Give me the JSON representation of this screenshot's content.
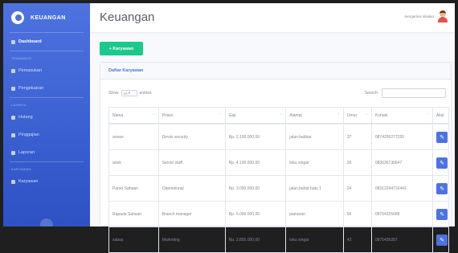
{
  "sidebar": {
    "brand": "KEUANGAN",
    "dashboard": "Dashboard",
    "heading_1": "TRANSAKSI",
    "items_1": [
      "Pemasukan",
      "Pengeluaran"
    ],
    "heading_2": "LAINNYA",
    "items_2": [
      "Hutang",
      "Pinggajian",
      "Laporan"
    ],
    "heading_3": "KARYAWAN",
    "items_3": [
      "Karyawan"
    ]
  },
  "topbar": {
    "title": "Keuangan",
    "user": "mergarinsi nikalan"
  },
  "main": {
    "add_button": "+ Karyawan",
    "card_title": "Daftar Karyawan",
    "show_label": "Show",
    "show_value": "10",
    "entries_label": "entries",
    "search_label": "Search:",
    "columns": [
      "Nama",
      "Posisi",
      "Gaji",
      "Alamat",
      "Umur",
      "Kontak",
      "Aksi"
    ],
    "rows": [
      [
        "arwan",
        "Devisi security",
        "Rp. 2.100.000,00",
        "jalan.babbar",
        "37",
        "0874256277255"
      ],
      [
        "anok",
        "Senior staff",
        "Rp. 4.100.000,00",
        "toku singar",
        "26",
        "083636736647"
      ],
      [
        "Paran Sahaan",
        "Operasional",
        "Rp. 3.000.000,00",
        "jalan.bahat batu 1",
        "24",
        "08312244716441"
      ],
      [
        "Rapada Sahaan",
        "Branch manager",
        "Rp. 6.000.000,00",
        "pamaran",
        "56",
        "08764325688"
      ],
      [
        "sabas",
        "Marketing",
        "Rp. 3.800.000,00",
        "toku singar",
        "43",
        "0875436287"
      ]
    ]
  }
}
